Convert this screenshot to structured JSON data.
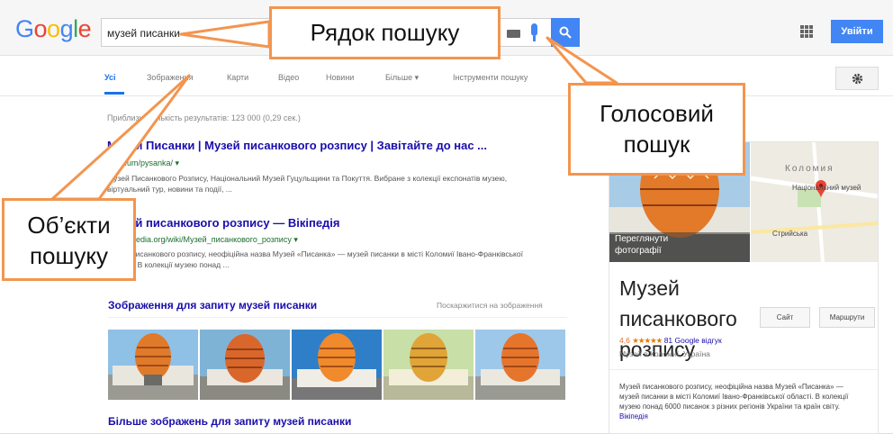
{
  "header": {
    "logo": [
      "G",
      "o",
      "o",
      "g",
      "l",
      "e"
    ],
    "logo_colors": [
      "#4285f4",
      "#ea4335",
      "#fbbc05",
      "#4285f4",
      "#34a853",
      "#ea4335"
    ],
    "search_query": "музей писанки",
    "signin_label": "Увійти"
  },
  "tabs": [
    {
      "label": "Усі",
      "active": true
    },
    {
      "label": "Зображення"
    },
    {
      "label": "Карти"
    },
    {
      "label": "Відео"
    },
    {
      "label": "Новини"
    },
    {
      "label": "Більше ▾"
    },
    {
      "label": "Інструменти пошуку"
    }
  ],
  "results": {
    "stats": "Приблизна кількість результатів: 123 000 (0,29 сек.)",
    "items": [
      {
        "title": "Музей Писанки | Музей писанкового розпису | Завітайте до нас ...",
        "url": "museum/pysanka/ ▾",
        "snippet": "Музей Писанкового Розпису, Національний Музей Гуцульщини та Покуття. Вибране з колекції експонатів музею, віртуальний тур, новини та події, ..."
      },
      {
        "title": "Музей писанкового розпису — Вікіпедія",
        "url": "uk.wikipedia.org/wiki/Музей_писанкового_розпису ▾",
        "snippet": "Музей писанкового розпису, неофіційна назва Музей «Писанка» — музей писанки в місті Коломиї Івано-Франківської області. В колекції музею понад ..."
      }
    ]
  },
  "images": {
    "heading": "Зображення для запиту музей писанки",
    "report": "Поскаржитися на зображення",
    "more": "Більше зображень для запиту музей писанки"
  },
  "knowledge_panel": {
    "photo_label": "Переглянути фотографії",
    "map_labels": {
      "city": "Коломия",
      "museum": "Національний музей",
      "street": "Стрийська"
    },
    "title": "Музей писанкового розпису",
    "buttons": {
      "site": "Сайт",
      "route": "Маршрути"
    },
    "rating": "4,6",
    "stars": "★★★★★",
    "reviews": "81 Google відгук",
    "type": "Музей в Коломиї, Україна",
    "description": "Музей писанкового розпису, неофіційна назва Музей «Писанка» — музей писанки в місті Коломиї Івано-Франківської області. В колекції музею понад 6000 писанок з різних регіонів України та країн світу.",
    "more": "Вікіпедія"
  },
  "callouts": {
    "search_bar": "Рядок пошуку",
    "voice_search": [
      "Голосовий",
      "пошук"
    ],
    "search_objects": [
      "Об’єкти",
      "пошуку"
    ]
  }
}
